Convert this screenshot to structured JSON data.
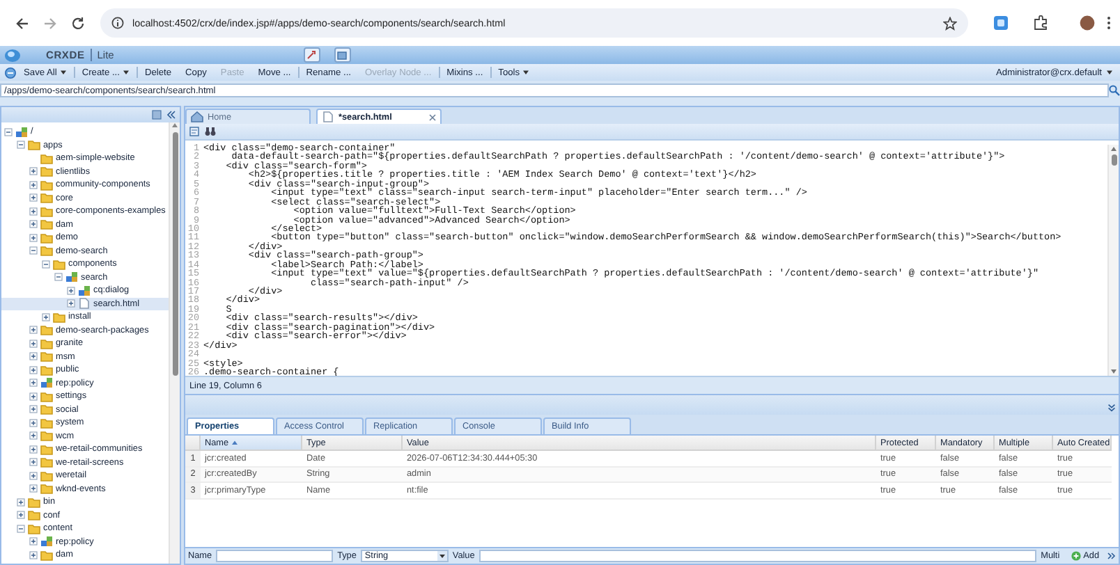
{
  "browser": {
    "url": "localhost:4502/crx/de/index.jsp#/apps/demo-search/components/search/search.html"
  },
  "app": {
    "title": "CRXDE",
    "subtitle": "Lite",
    "user": "Administrator@crx.default",
    "toolbar": [
      {
        "label": "Save All",
        "dropdown": true,
        "disabled": false
      },
      {
        "label": "Create ...",
        "dropdown": true,
        "disabled": false
      },
      {
        "label": "Delete",
        "dropdown": false,
        "disabled": false
      },
      {
        "label": "Copy",
        "dropdown": false,
        "disabled": false
      },
      {
        "label": "Paste",
        "dropdown": false,
        "disabled": true
      },
      {
        "label": "Move ...",
        "dropdown": false,
        "disabled": false
      },
      {
        "label": "Rename ...",
        "dropdown": false,
        "disabled": false
      },
      {
        "label": "Overlay Node ...",
        "dropdown": false,
        "disabled": true
      },
      {
        "label": "Mixins ...",
        "dropdown": false,
        "disabled": false
      },
      {
        "label": "Tools",
        "dropdown": true,
        "disabled": false
      }
    ],
    "path": "/apps/demo-search/components/search/search.html"
  },
  "tree": [
    {
      "label": "/",
      "kind": "node",
      "leaf": false,
      "expanded": true,
      "selected": false,
      "children": [
        {
          "label": "apps",
          "kind": "folder",
          "leaf": false,
          "expanded": true,
          "selected": false,
          "children": [
            {
              "label": "aem-simple-website",
              "kind": "folder",
              "leaf": true,
              "selected": false
            },
            {
              "label": "clientlibs",
              "kind": "folder",
              "leaf": false,
              "expanded": false,
              "selected": false
            },
            {
              "label": "community-components",
              "kind": "folder",
              "leaf": false,
              "expanded": false,
              "selected": false
            },
            {
              "label": "core",
              "kind": "folder",
              "leaf": false,
              "expanded": false,
              "selected": false
            },
            {
              "label": "core-components-examples",
              "kind": "folder",
              "leaf": false,
              "expanded": false,
              "selected": false
            },
            {
              "label": "dam",
              "kind": "folder",
              "leaf": false,
              "expanded": false,
              "selected": false
            },
            {
              "label": "demo",
              "kind": "folder",
              "leaf": false,
              "expanded": false,
              "selected": false
            },
            {
              "label": "demo-search",
              "kind": "folder",
              "leaf": false,
              "expanded": true,
              "selected": false,
              "children": [
                {
                  "label": "components",
                  "kind": "folder",
                  "leaf": false,
                  "expanded": true,
                  "selected": false,
                  "children": [
                    {
                      "label": "search",
                      "kind": "node",
                      "leaf": false,
                      "expanded": true,
                      "selected": false,
                      "children": [
                        {
                          "label": "cq:dialog",
                          "kind": "node",
                          "leaf": false,
                          "expanded": false,
                          "selected": false
                        },
                        {
                          "label": "search.html",
                          "kind": "file",
                          "leaf": false,
                          "expanded": false,
                          "selected": true
                        }
                      ]
                    }
                  ]
                },
                {
                  "label": "install",
                  "kind": "folder",
                  "leaf": false,
                  "expanded": false,
                  "selected": false
                }
              ]
            },
            {
              "label": "demo-search-packages",
              "kind": "folder",
              "leaf": false,
              "expanded": false,
              "selected": false
            },
            {
              "label": "granite",
              "kind": "folder",
              "leaf": false,
              "expanded": false,
              "selected": false
            },
            {
              "label": "msm",
              "kind": "folder",
              "leaf": false,
              "expanded": false,
              "selected": false
            },
            {
              "label": "public",
              "kind": "folder",
              "leaf": false,
              "expanded": false,
              "selected": false
            },
            {
              "label": "rep:policy",
              "kind": "node",
              "leaf": false,
              "expanded": false,
              "selected": false
            },
            {
              "label": "settings",
              "kind": "folder",
              "leaf": false,
              "expanded": false,
              "selected": false
            },
            {
              "label": "social",
              "kind": "folder",
              "leaf": false,
              "expanded": false,
              "selected": false
            },
            {
              "label": "system",
              "kind": "folder",
              "leaf": false,
              "expanded": false,
              "selected": false
            },
            {
              "label": "wcm",
              "kind": "folder",
              "leaf": false,
              "expanded": false,
              "selected": false
            },
            {
              "label": "we-retail-communities",
              "kind": "folder",
              "leaf": false,
              "expanded": false,
              "selected": false
            },
            {
              "label": "we-retail-screens",
              "kind": "folder",
              "leaf": false,
              "expanded": false,
              "selected": false
            },
            {
              "label": "weretail",
              "kind": "folder",
              "leaf": false,
              "expanded": false,
              "selected": false
            },
            {
              "label": "wknd-events",
              "kind": "folder",
              "leaf": false,
              "expanded": false,
              "selected": false
            }
          ]
        },
        {
          "label": "bin",
          "kind": "folder",
          "leaf": false,
          "expanded": false,
          "selected": false
        },
        {
          "label": "conf",
          "kind": "folder",
          "leaf": false,
          "expanded": false,
          "selected": false
        },
        {
          "label": "content",
          "kind": "folder",
          "leaf": false,
          "expanded": true,
          "selected": false,
          "children": [
            {
              "label": "rep:policy",
              "kind": "node",
              "leaf": false,
              "expanded": false,
              "selected": false
            },
            {
              "label": "dam",
              "kind": "folder",
              "leaf": false,
              "expanded": false,
              "selected": false
            }
          ]
        }
      ]
    }
  ],
  "editor": {
    "tabs": [
      {
        "label": "Home",
        "kind": "home",
        "selected": false
      },
      {
        "label": "*search.html",
        "kind": "file",
        "selected": true
      }
    ],
    "lines": [
      {
        "number": "1",
        "text": "<div class=\"demo-search-container\""
      },
      {
        "number": "2",
        "text": "     data-default-search-path=\"${properties.defaultSearchPath ? properties.defaultSearchPath : '/content/demo-search' @ context='attribute'}\">"
      },
      {
        "number": "3",
        "text": "    <div class=\"search-form\">"
      },
      {
        "number": "4",
        "text": "        <h2>${properties.title ? properties.title : 'AEM Index Search Demo' @ context='text'}</h2>"
      },
      {
        "number": "5",
        "text": "        <div class=\"search-input-group\">"
      },
      {
        "number": "6",
        "text": "            <input type=\"text\" class=\"search-input search-term-input\" placeholder=\"Enter search term...\" />"
      },
      {
        "number": "7",
        "text": "            <select class=\"search-select\">"
      },
      {
        "number": "8",
        "text": "                <option value=\"fulltext\">Full-Text Search</option>"
      },
      {
        "number": "9",
        "text": "                <option value=\"advanced\">Advanced Search</option>"
      },
      {
        "number": "10",
        "text": "            </select>"
      },
      {
        "number": "11",
        "text": "            <button type=\"button\" class=\"search-button\" onclick=\"window.demoSearchPerformSearch && window.demoSearchPerformSearch(this)\">Search</button>"
      },
      {
        "number": "12",
        "text": "        </div>"
      },
      {
        "number": "13",
        "text": "        <div class=\"search-path-group\">"
      },
      {
        "number": "14",
        "text": "            <label>Search Path:</label>"
      },
      {
        "number": "15",
        "text": "            <input type=\"text\" value=\"${properties.defaultSearchPath ? properties.defaultSearchPath : '/content/demo-search' @ context='attribute'}\""
      },
      {
        "number": "16",
        "text": "                   class=\"search-path-input\" />"
      },
      {
        "number": "17",
        "text": "        </div>"
      },
      {
        "number": "18",
        "text": "    </div>"
      },
      {
        "number": "19",
        "text": "    S"
      },
      {
        "number": "20",
        "text": "    <div class=\"search-results\"></div>"
      },
      {
        "number": "21",
        "text": "    <div class=\"search-pagination\"></div>"
      },
      {
        "number": "22",
        "text": "    <div class=\"search-error\"></div>"
      },
      {
        "number": "23",
        "text": "</div>"
      },
      {
        "number": "24"
      },
      {
        "number": "25",
        "text": "<style>"
      },
      {
        "number": "26",
        "text": ".demo-search-container {"
      }
    ],
    "status": "Line 19, Column 6"
  },
  "properties": {
    "tabs": [
      {
        "label": "Properties",
        "selected": true
      },
      {
        "label": "Access Control",
        "selected": false
      },
      {
        "label": "Replication",
        "selected": false
      },
      {
        "label": "Console",
        "selected": false
      },
      {
        "label": "Build Info",
        "selected": false
      }
    ],
    "columns": [
      "Name",
      "Type",
      "Value",
      "Protected",
      "Mandatory",
      "Multiple",
      "Auto Created"
    ],
    "rows": [
      {
        "number": "1",
        "cells": [
          "jcr:created",
          "Date",
          "2026-07-06T12:34:30.444+05:30",
          "true",
          "false",
          "false",
          "true"
        ]
      },
      {
        "number": "2",
        "cells": [
          "jcr:createdBy",
          "String",
          "admin",
          "true",
          "false",
          "false",
          "true"
        ]
      },
      {
        "number": "3",
        "cells": [
          "jcr:primaryType",
          "Name",
          "nt:file",
          "true",
          "true",
          "false",
          "true"
        ]
      }
    ],
    "form": {
      "name_label": "Name",
      "type_label": "Type",
      "type_value": "String",
      "value_label": "Value",
      "multi_label": "Multi",
      "add_label": "Add"
    }
  }
}
